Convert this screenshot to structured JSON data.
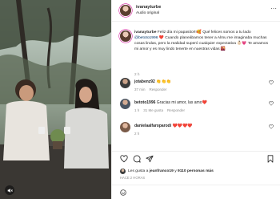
{
  "header": {
    "username": "ivanayturbe",
    "audio_label": "Audio original",
    "more_glyph": "···"
  },
  "caption": {
    "username": "ivanayturbe",
    "text_1": " Feliz día mi papasito!!!🥰 Qué felices somos a tu lado ",
    "mention": "@betoto1996",
    "text_2": " ❤️ Cuando planeábamos tener a Almu me imaginaba muchas cosas lindas, pero la realidad superó cualquier expectativa 👶🏻💗 Te amamos mi amor y es muy lindo tenerte en nuestras vidas 🌇",
    "time": "2 h"
  },
  "comments": [
    {
      "username": "jotabenz92",
      "text": "👏👏👏",
      "time": "37 min",
      "likes": "",
      "reply": "Responder",
      "avatar_color": "#3b3b3b"
    },
    {
      "username": "betoto1996",
      "text": "Gracias mi amor, las amo❤️",
      "time": "1 h",
      "likes": "31 Me gusta",
      "reply": "Responder",
      "avatar_color": "#4a5563"
    },
    {
      "username": "danielaalfaroparodi",
      "text": "❤️❤️❤️❤️",
      "time": "2 h",
      "likes": "",
      "reply": "",
      "avatar_color": "#7a5a48"
    }
  ],
  "likes": {
    "prefix": "Les gusta a ",
    "first_user": "jeanfranco19",
    "middle": " y ",
    "others": "9110 personas más"
  },
  "post_date": "HACE 2 HORAS",
  "colors": {
    "text_primary": "#262626",
    "text_secondary": "#8e8e8e",
    "mention": "#00376b",
    "heart_red": "#ed4956",
    "divider": "#efefef"
  },
  "icons": [
    "heart-icon",
    "comment-icon",
    "share-icon",
    "bookmark-icon",
    "emoji-icon",
    "mute-icon",
    "more-icon"
  ]
}
